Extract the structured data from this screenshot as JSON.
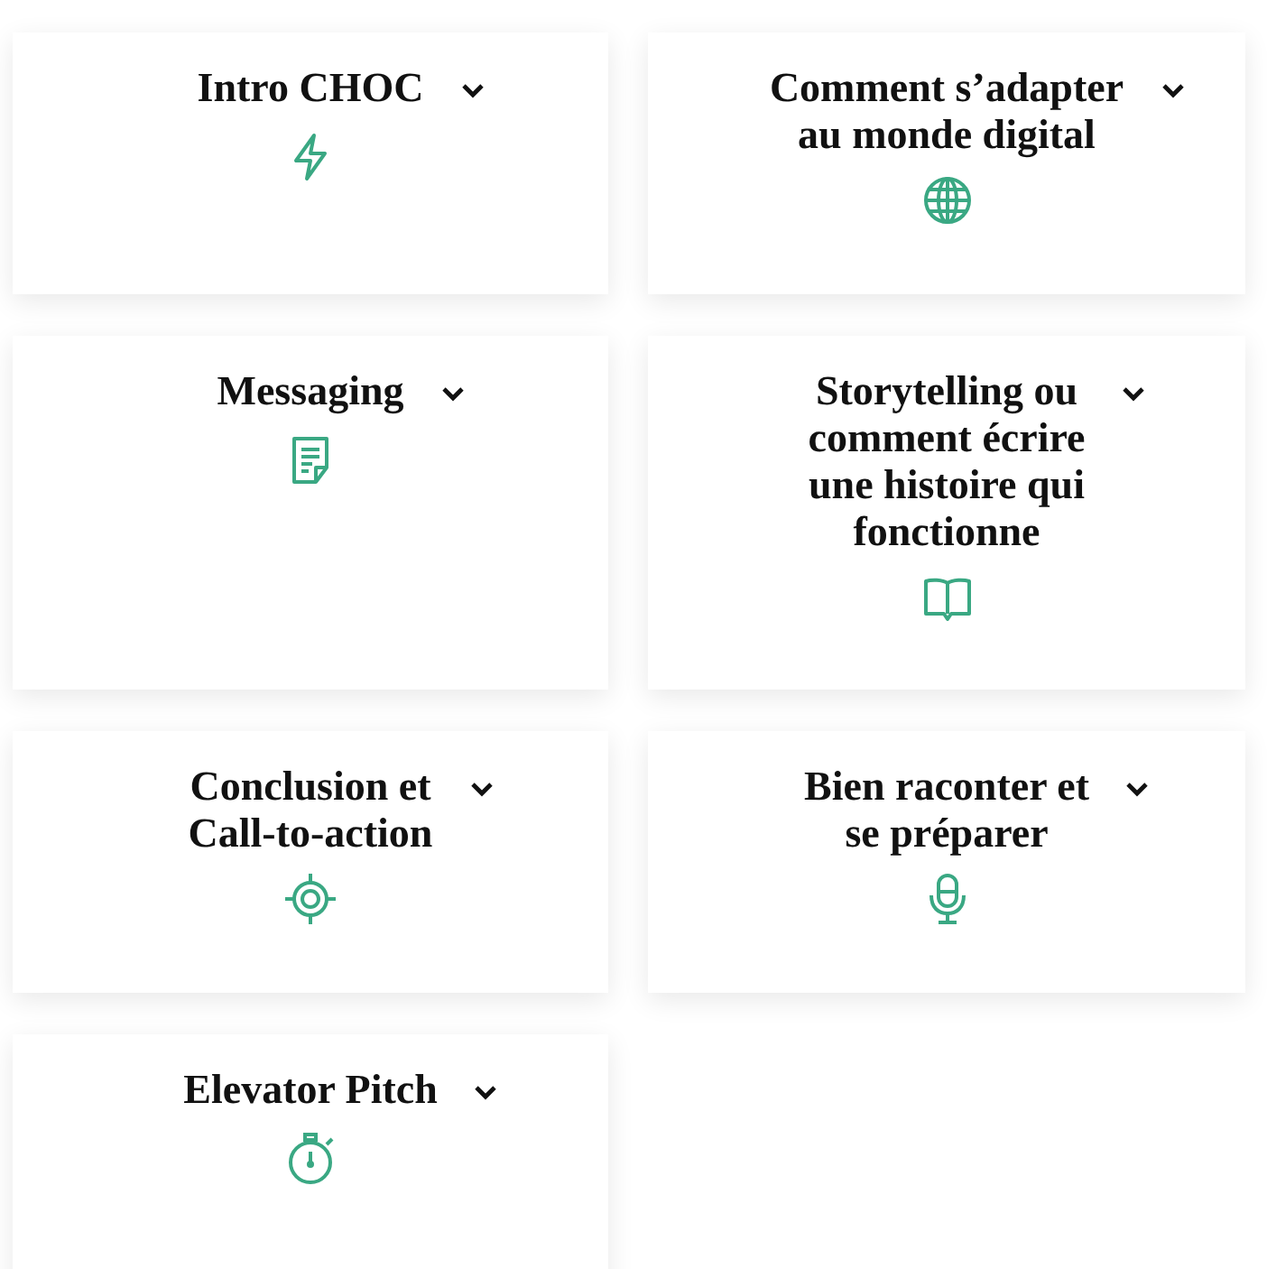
{
  "cards": [
    {
      "title": "Intro CHOC",
      "expanded": false
    },
    {
      "title": "Comment s’adapter\nau monde digital",
      "expanded": false
    },
    {
      "title": "Messaging",
      "expanded": false
    },
    {
      "title": "Storytelling ou\ncomment écrire\nune histoire qui\nfonctionne",
      "expanded": false
    },
    {
      "title": "Conclusion et\nCall-to-action",
      "expanded": false
    },
    {
      "title": "Bien raconter et\nse préparer",
      "expanded": false
    },
    {
      "title": "Elevator Pitch",
      "expanded": false
    }
  ]
}
